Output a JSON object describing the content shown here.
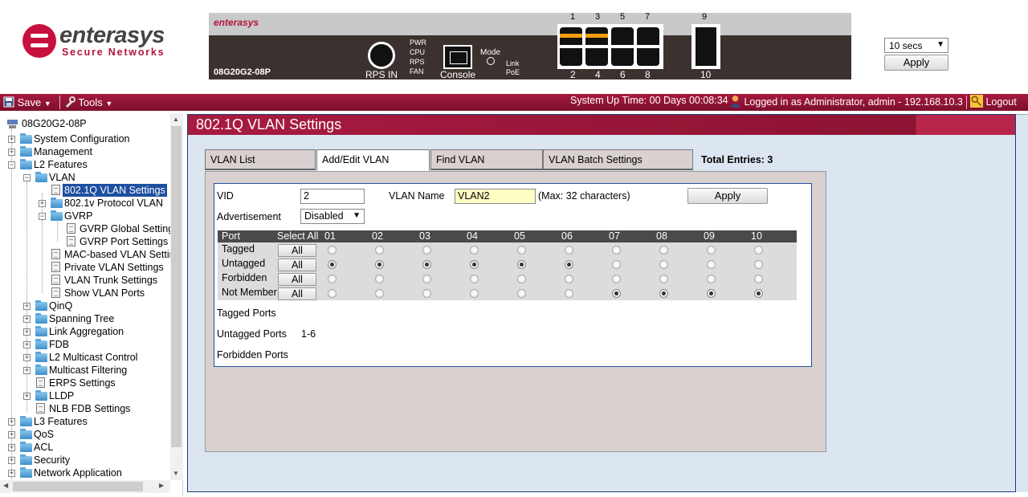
{
  "header": {
    "brand": "enterasys",
    "tagline": "Secure Networks",
    "device_brand": "enterasys",
    "device_model": "08G20G2-08P",
    "rps_label": "RPS IN",
    "led_labels": [
      "PWR",
      "CPU",
      "RPS",
      "FAN"
    ],
    "console_label": "Console",
    "mode_label": "Mode",
    "link_label": "Link",
    "poe_label": "PoE",
    "port_top_numbers": [
      "1",
      "3",
      "5",
      "7"
    ],
    "port_bottom_numbers": [
      "2",
      "4",
      "6",
      "8"
    ],
    "port_9": "9",
    "port_10": "10",
    "refresh_value": "10 secs",
    "refresh_apply": "Apply"
  },
  "toolbar": {
    "save_label": "Save",
    "tools_label": "Tools",
    "uptime": "System Up Time: 00 Days 00:08:34",
    "logged_in": "Logged in as Administrator, admin - 192.168.10.3",
    "logout_label": "Logout"
  },
  "tree": {
    "root": "08G20G2-08P",
    "system_configuration": "System Configuration",
    "management": "Management",
    "l2_features": "L2 Features",
    "vlan": "VLAN",
    "vlan_8021q": "802.1Q VLAN Settings",
    "vlan_8021v": "802.1v Protocol VLAN",
    "gvrp": "GVRP",
    "gvrp_global": "GVRP Global Settings",
    "gvrp_port": "GVRP Port Settings",
    "mac_vlan": "MAC-based VLAN Settings",
    "private_vlan": "Private VLAN Settings",
    "vlan_trunk": "VLAN Trunk Settings",
    "show_vlan_ports": "Show VLAN Ports",
    "qinq": "QinQ",
    "spanning_tree": "Spanning Tree",
    "link_aggregation": "Link Aggregation",
    "fdb": "FDB",
    "l2_multicast": "L2 Multicast Control",
    "multicast_filtering": "Multicast Filtering",
    "erps": "ERPS Settings",
    "lldp": "LLDP",
    "nlb_fdb": "NLB FDB Settings",
    "l3_features": "L3 Features",
    "qos": "QoS",
    "acl": "ACL",
    "security": "Security",
    "network_application": "Network Application"
  },
  "main": {
    "title": "802.1Q VLAN Settings",
    "tabs": [
      "VLAN List",
      "Add/Edit VLAN",
      "Find VLAN",
      "VLAN Batch Settings"
    ],
    "active_tab": "Add/Edit VLAN",
    "total_entries": "Total Entries: 3",
    "form": {
      "vid_label": "VID",
      "vid_value": "2",
      "vlan_name_label": "VLAN Name",
      "vlan_name_value": "VLAN2",
      "max_hint": "(Max: 32 characters)",
      "apply_label": "Apply",
      "advertisement_label": "Advertisement",
      "advertisement_value": "Disabled"
    },
    "port_table": {
      "headers": {
        "port": "Port",
        "select_all": "Select All"
      },
      "ports": [
        "01",
        "02",
        "03",
        "04",
        "05",
        "06",
        "07",
        "08",
        "09",
        "10"
      ],
      "rows": [
        {
          "label": "Tagged",
          "button": "All",
          "selected_ports": []
        },
        {
          "label": "Untagged",
          "button": "All",
          "selected_ports": [
            "01",
            "02",
            "03",
            "04",
            "05",
            "06"
          ]
        },
        {
          "label": "Forbidden",
          "button": "All",
          "selected_ports": []
        },
        {
          "label": "Not Member",
          "button": "All",
          "selected_ports": [
            "07",
            "08",
            "09",
            "10"
          ]
        }
      ]
    },
    "summary": {
      "tagged_label": "Tagged Ports",
      "tagged_value": "",
      "untagged_label": "Untagged Ports",
      "untagged_value": "1-6",
      "forbidden_label": "Forbidden Ports",
      "forbidden_value": ""
    }
  },
  "colors": {
    "accent": "#9e1838",
    "selection": "#1e4fa0",
    "port_led_amber": "#f39c12"
  }
}
